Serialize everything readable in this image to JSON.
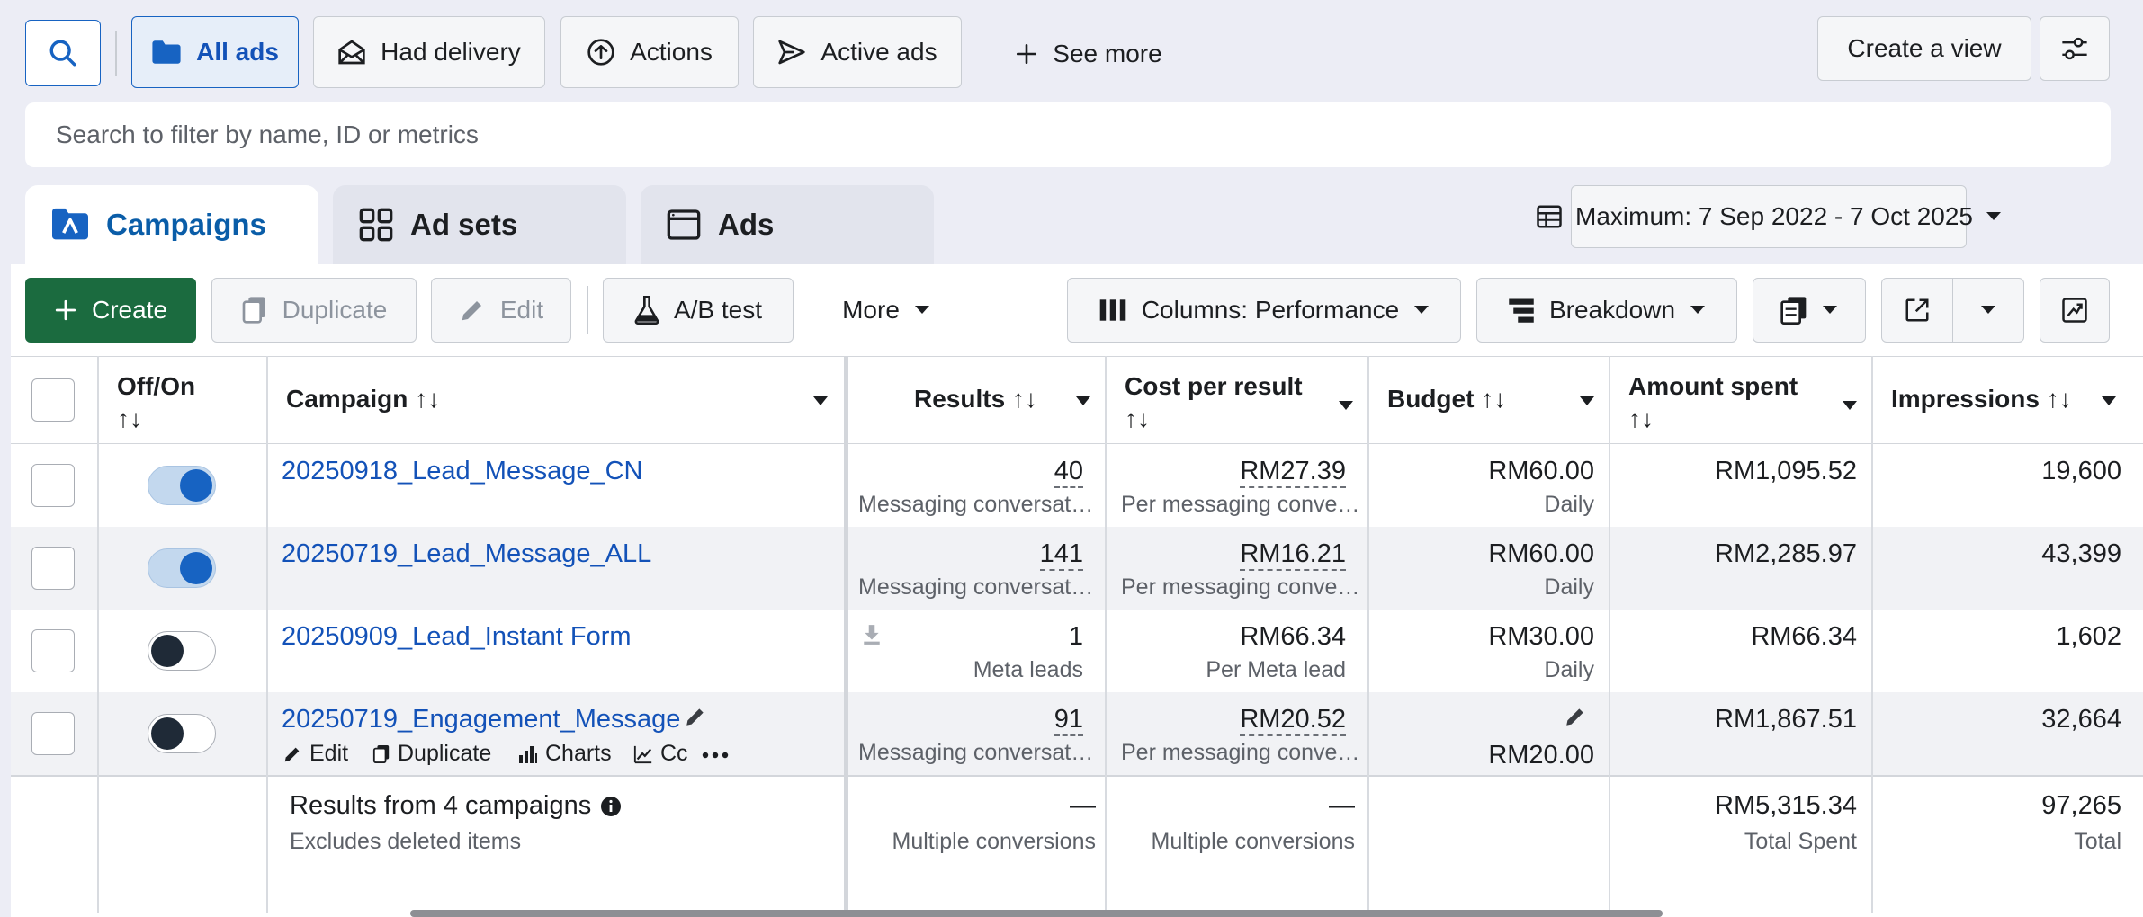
{
  "filters": {
    "all_ads": "All ads",
    "had_delivery": "Had delivery",
    "actions": "Actions",
    "active_ads": "Active ads",
    "see_more": "See more",
    "create_view": "Create a view"
  },
  "search": {
    "placeholder": "Search to filter by name, ID or metrics"
  },
  "tabs": {
    "campaigns": "Campaigns",
    "ad_sets": "Ad sets",
    "ads": "Ads"
  },
  "date_range": "Maximum: 7 Sep 2022 - 7 Oct 2025",
  "toolbar": {
    "create": "Create",
    "duplicate": "Duplicate",
    "edit": "Edit",
    "ab_test": "A/B test",
    "more": "More",
    "columns": "Columns: Performance",
    "breakdown": "Breakdown"
  },
  "columns": {
    "offon_1": "Off/On",
    "offon_2": "↑↓",
    "campaign": "Campaign ↑↓",
    "results": "Results ↑↓",
    "cost_1": "Cost per result",
    "cost_2": "↑↓",
    "budget": "Budget ↑↓",
    "spent_1": "Amount spent",
    "spent_2": "↑↓",
    "impressions": "Impressions ↑↓"
  },
  "rows": [
    {
      "on": true,
      "name": "20250918_Lead_Message_CN",
      "results": "40",
      "results_sub": "Messaging conversat…",
      "cost": "RM27.39",
      "cost_sub": "Per messaging conve…",
      "budget": "RM60.00",
      "budget_sub": "Daily",
      "spent": "RM1,095.52",
      "impressions": "19,600"
    },
    {
      "on": true,
      "name": "20250719_Lead_Message_ALL",
      "results": "141",
      "results_sub": "Messaging conversat…",
      "cost": "RM16.21",
      "cost_sub": "Per messaging conve…",
      "budget": "RM60.00",
      "budget_sub": "Daily",
      "spent": "RM2,285.97",
      "impressions": "43,399"
    },
    {
      "on": false,
      "name": "20250909_Lead_Instant Form",
      "results": "1",
      "results_sub": "Meta leads",
      "cost": "RM66.34",
      "cost_sub": "Per Meta lead",
      "budget": "RM30.00",
      "budget_sub": "Daily",
      "spent": "RM66.34",
      "impressions": "1,602"
    },
    {
      "on": false,
      "name": "20250719_Engagement_Message",
      "results": "91",
      "results_sub": "Messaging conversat…",
      "cost": "RM20.52",
      "cost_sub": "Per messaging conve…",
      "budget": "RM20.00",
      "budget_sub": "",
      "spent": "RM1,867.51",
      "impressions": "32,664"
    }
  ],
  "row_actions": {
    "edit": "Edit",
    "duplicate": "Duplicate",
    "charts": "Charts",
    "compare": "Cc"
  },
  "summary": {
    "title": "Results from 4 campaigns",
    "subtitle": "Excludes deleted items",
    "results": "—",
    "results_sub": "Multiple conversions",
    "cost": "—",
    "cost_sub": "Multiple conversions",
    "spent": "RM5,315.34",
    "spent_sub": "Total Spent",
    "impressions": "97,265",
    "impressions_sub": "Total"
  }
}
